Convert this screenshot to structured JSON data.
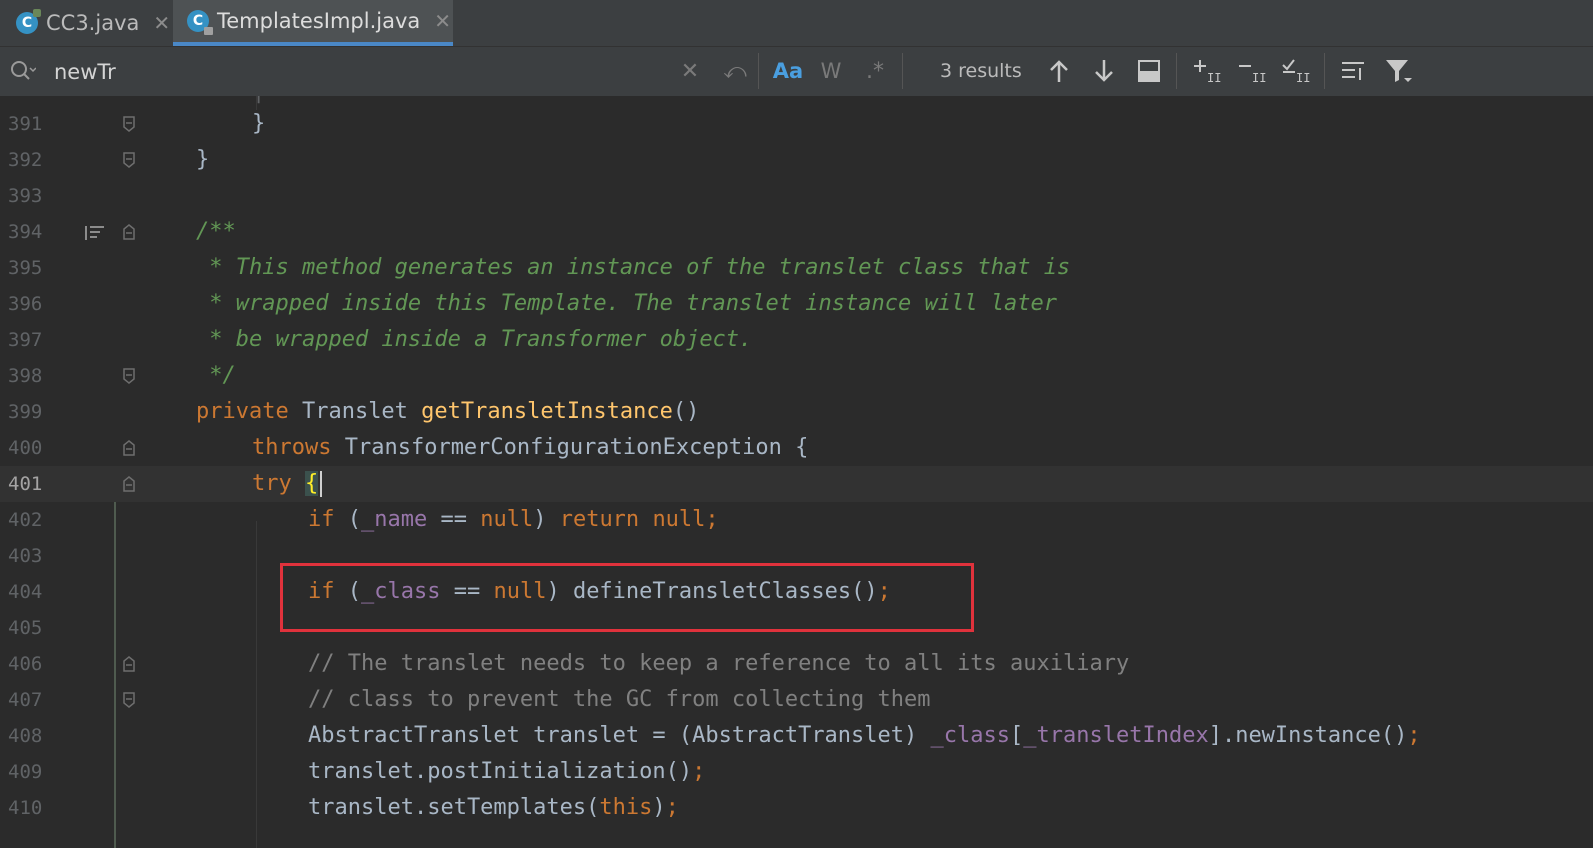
{
  "tabs": [
    {
      "label": "CC3.java",
      "icon": "java-class-icon",
      "active": false
    },
    {
      "label": "TemplatesImpl.java",
      "icon": "java-class-readonly-icon",
      "active": true
    }
  ],
  "find": {
    "query": "newTr",
    "results": "3 results",
    "match_case_label": "Aa",
    "words_label": "W",
    "regex_label": ".*"
  },
  "icons": {
    "close": "✕",
    "replace": "⤺",
    "up": "🡑",
    "down": "🡓"
  },
  "colors": {
    "accent": "#4a88c7",
    "keyword": "#cc7832",
    "doc_comment": "#629755",
    "highlight_box": "#e0323c"
  },
  "editor": {
    "lines": [
      {
        "num": "391",
        "code": "}"
      },
      {
        "num": "392",
        "code": "}"
      },
      {
        "num": "393",
        "code": ""
      },
      {
        "num": "394",
        "code": "/**"
      },
      {
        "num": "395",
        "code": " * This method generates an instance of the translet class that is"
      },
      {
        "num": "396",
        "code": " * wrapped inside this Template. The translet instance will later"
      },
      {
        "num": "397",
        "code": " * be wrapped inside a Transformer object."
      },
      {
        "num": "398",
        "code": " */"
      },
      {
        "num": "399",
        "code": "private Translet getTransletInstance()"
      },
      {
        "num": "400",
        "code": "throws TransformerConfigurationException {"
      },
      {
        "num": "401",
        "code": "try {"
      },
      {
        "num": "402",
        "code": "if (_name == null) return null;"
      },
      {
        "num": "403",
        "code": ""
      },
      {
        "num": "404",
        "code": "if (_class == null) defineTransletClasses();"
      },
      {
        "num": "405",
        "code": ""
      },
      {
        "num": "406",
        "code": "// The translet needs to keep a reference to all its auxiliary"
      },
      {
        "num": "407",
        "code": "// class to prevent the GC from collecting them"
      },
      {
        "num": "408",
        "code": "AbstractTranslet translet = (AbstractTranslet) _class[_transletIndex].newInstance();"
      },
      {
        "num": "409",
        "code": "translet.postInitialization();"
      },
      {
        "num": "410",
        "code": "translet.setTemplates(this);"
      }
    ],
    "tokens": {
      "l391": [
        "}"
      ],
      "l392": [
        "}"
      ],
      "l394": [
        "/**"
      ],
      "l395": [
        " * This method generates an instance of the translet class that is"
      ],
      "l396": [
        " * wrapped inside this Template. The translet instance will later"
      ],
      "l397": [
        " * be wrapped inside a Transformer object."
      ],
      "l398": [
        " */"
      ],
      "l399": [
        "private",
        " Translet ",
        "getTransletInstance",
        "()"
      ],
      "l400": [
        "throws",
        " TransformerConfigurationException {"
      ],
      "l401": [
        "try",
        " ",
        "{"
      ],
      "l402": [
        "if",
        " (",
        "_name",
        " == ",
        "null",
        ") ",
        "return",
        " ",
        "null",
        ";"
      ],
      "l404": [
        "if",
        " (",
        "_class",
        " == ",
        "null",
        ") defineTransletClasses()",
        ";"
      ],
      "l406": [
        "// The translet needs to keep a reference to all its auxiliary"
      ],
      "l407": [
        "// class to prevent the GC from collecting them"
      ],
      "l408": [
        "AbstractTranslet translet = (AbstractTranslet) ",
        "_class",
        "[",
        "_transletIndex",
        "].newInstance()",
        ";"
      ],
      "l409": [
        "translet.postInitialization()",
        ";"
      ],
      "l410": [
        "translet.setTemplates(",
        "this",
        ")",
        ";"
      ]
    }
  }
}
